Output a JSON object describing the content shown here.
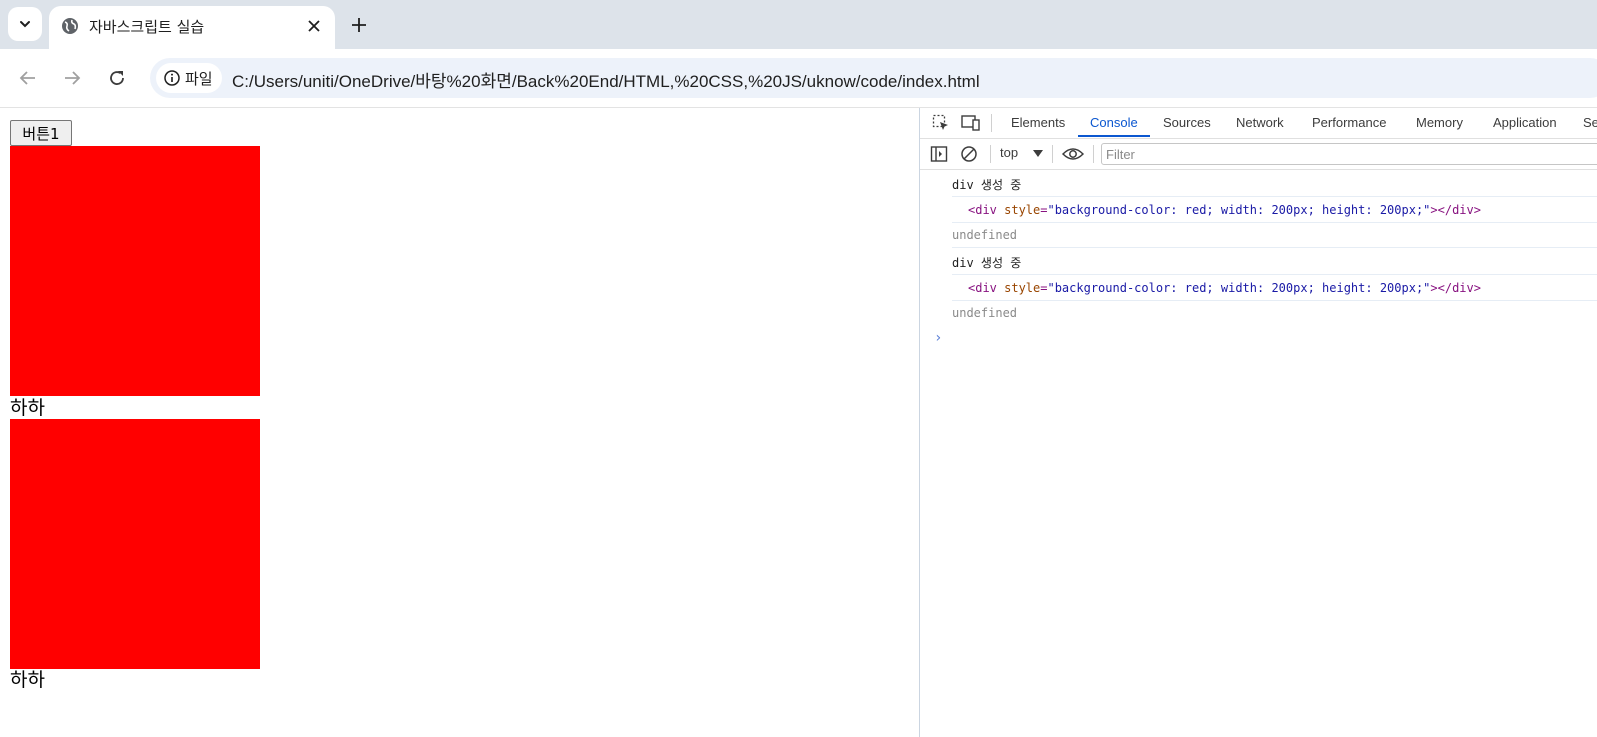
{
  "browser": {
    "tab_title": "자바스크립트 실습",
    "site_info_label": "파일",
    "url": "C:/Users/uniti/OneDrive/바탕%20화면/Back%20End/HTML,%20CSS,%20JS/uknow/code/index.html"
  },
  "page": {
    "button_label": "버튼1",
    "box_color": "#ff0000",
    "captions": [
      "하하",
      "하하"
    ]
  },
  "devtools": {
    "tabs": [
      "Elements",
      "Console",
      "Sources",
      "Network",
      "Performance",
      "Memory",
      "Application",
      "Se"
    ],
    "active_tab": "Console",
    "context": "top",
    "filter_placeholder": "Filter",
    "console": {
      "log1": "div 생성 중",
      "tag_open": "<div ",
      "attr_name": "style",
      "attr_eq": "=",
      "attr_value": "\"background-color: red; width: 200px; height: 200px;\"",
      "tag_close": "></div>",
      "result1": "undefined",
      "log2": "div 생성 중",
      "result2": "undefined",
      "prompt": "›"
    }
  }
}
